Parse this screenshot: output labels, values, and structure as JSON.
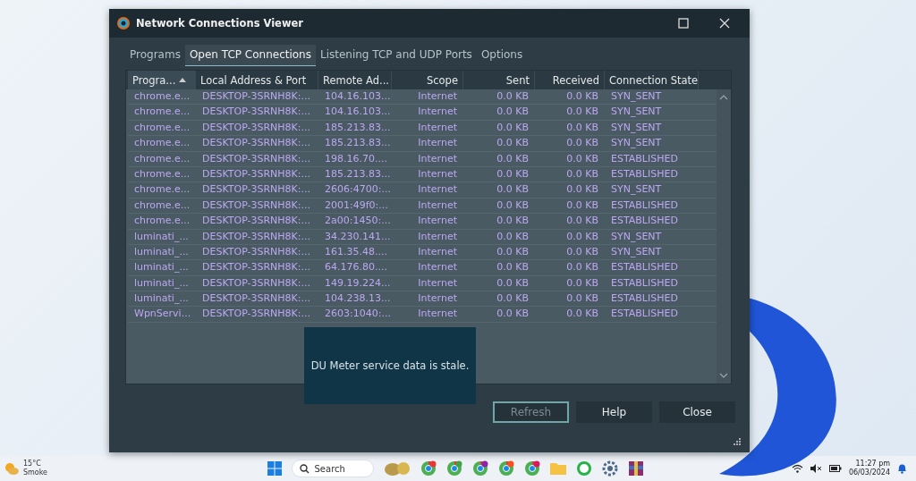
{
  "window": {
    "title": "Network Connections Viewer"
  },
  "tabs": [
    {
      "label": "Programs",
      "selected": false
    },
    {
      "label": "Open TCP Connections",
      "selected": true
    },
    {
      "label": "Listening TCP and UDP Ports",
      "selected": false
    },
    {
      "label": "Options",
      "selected": false
    }
  ],
  "table": {
    "columns": [
      {
        "label": "Progra...",
        "sorted": true
      },
      {
        "label": "Local Address & Port",
        "sorted": false
      },
      {
        "label": "Remote Ad...",
        "sorted": false
      },
      {
        "label": "Scope",
        "sorted": false
      },
      {
        "label": "Sent",
        "sorted": false
      },
      {
        "label": "Received",
        "sorted": false
      },
      {
        "label": "Connection State",
        "sorted": false
      }
    ],
    "rows": [
      [
        "chrome.e...",
        "DESKTOP-3SRNH8K:...",
        "104.16.103...",
        "Internet",
        "0.0 KB",
        "0.0 KB",
        "SYN_SENT"
      ],
      [
        "chrome.e...",
        "DESKTOP-3SRNH8K:...",
        "104.16.103...",
        "Internet",
        "0.0 KB",
        "0.0 KB",
        "SYN_SENT"
      ],
      [
        "chrome.e...",
        "DESKTOP-3SRNH8K:...",
        "185.213.83...",
        "Internet",
        "0.0 KB",
        "0.0 KB",
        "SYN_SENT"
      ],
      [
        "chrome.e...",
        "DESKTOP-3SRNH8K:...",
        "185.213.83...",
        "Internet",
        "0.0 KB",
        "0.0 KB",
        "SYN_SENT"
      ],
      [
        "chrome.e...",
        "DESKTOP-3SRNH8K:...",
        "198.16.70....",
        "Internet",
        "0.0 KB",
        "0.0 KB",
        "ESTABLISHED"
      ],
      [
        "chrome.e...",
        "DESKTOP-3SRNH8K:...",
        "185.213.83...",
        "Internet",
        "0.0 KB",
        "0.0 KB",
        "ESTABLISHED"
      ],
      [
        "chrome.e...",
        "DESKTOP-3SRNH8K:...",
        "2606:4700:...",
        "Internet",
        "0.0 KB",
        "0.0 KB",
        "SYN_SENT"
      ],
      [
        "chrome.e...",
        "DESKTOP-3SRNH8K:...",
        "2001:49f0:...",
        "Internet",
        "0.0 KB",
        "0.0 KB",
        "ESTABLISHED"
      ],
      [
        "chrome.e...",
        "DESKTOP-3SRNH8K:...",
        "2a00:1450:...",
        "Internet",
        "0.0 KB",
        "0.0 KB",
        "ESTABLISHED"
      ],
      [
        "luminati_...",
        "DESKTOP-3SRNH8K:...",
        "34.230.141...",
        "Internet",
        "0.0 KB",
        "0.0 KB",
        "SYN_SENT"
      ],
      [
        "luminati_...",
        "DESKTOP-3SRNH8K:...",
        "161.35.48....",
        "Internet",
        "0.0 KB",
        "0.0 KB",
        "SYN_SENT"
      ],
      [
        "luminati_...",
        "DESKTOP-3SRNH8K:...",
        "64.176.80....",
        "Internet",
        "0.0 KB",
        "0.0 KB",
        "ESTABLISHED"
      ],
      [
        "luminati_...",
        "DESKTOP-3SRNH8K:...",
        "149.19.224...",
        "Internet",
        "0.0 KB",
        "0.0 KB",
        "ESTABLISHED"
      ],
      [
        "luminati_...",
        "DESKTOP-3SRNH8K:...",
        "104.238.13...",
        "Internet",
        "0.0 KB",
        "0.0 KB",
        "ESTABLISHED"
      ],
      [
        "WpnServi...",
        "DESKTOP-3SRNH8K:...",
        "2603:1040:...",
        "Internet",
        "0.0 KB",
        "0.0 KB",
        "ESTABLISHED"
      ]
    ]
  },
  "tooltip": {
    "text": "DU Meter service data is stale."
  },
  "buttons": [
    {
      "label": "Refresh",
      "disabled": true
    },
    {
      "label": "Help",
      "disabled": false
    },
    {
      "label": "Close",
      "disabled": false
    }
  ],
  "taskbar": {
    "temperature": "15°C",
    "weather": "Smoke",
    "search": {
      "placeholder": "Search"
    },
    "time": "11:27 pm",
    "date": "06/03/2024"
  }
}
